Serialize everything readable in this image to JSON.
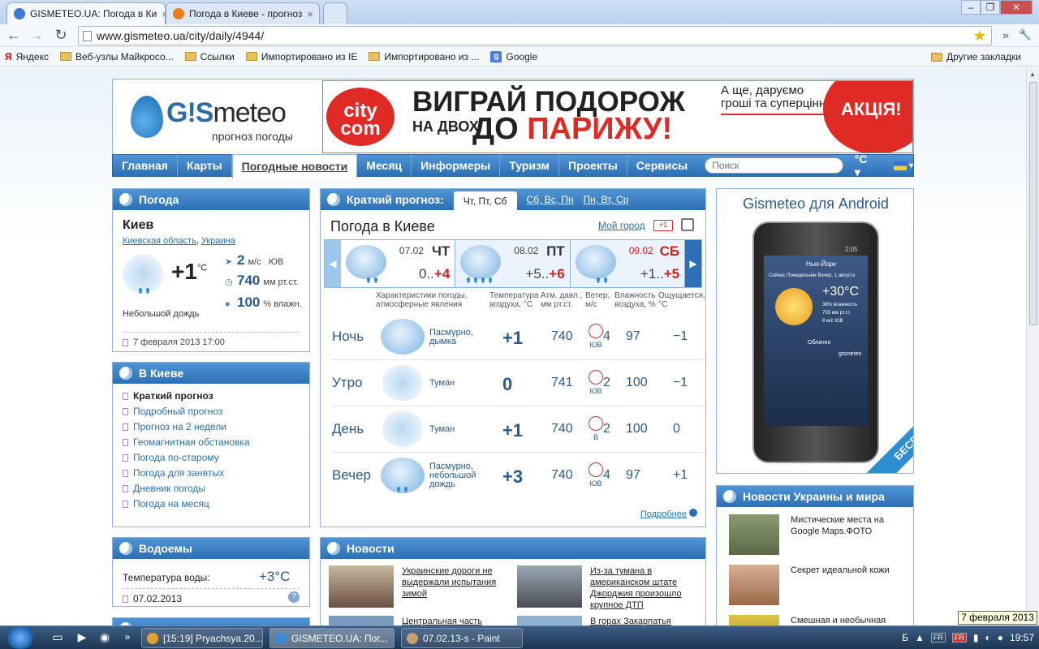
{
  "browser": {
    "tabs": [
      {
        "title": "GISMETEO.UA: Погода в Ки",
        "close": "×",
        "favicon_color": "#3b78d8",
        "active": true
      },
      {
        "title": "Погода в Киеве - прогноз",
        "close": "×",
        "favicon_color": "#ef7d12",
        "active": false
      }
    ],
    "window_controls": {
      "minimize": "–",
      "restore": "❐",
      "close": "✕"
    },
    "url": "www.gismeteo.ua/city/daily/4944/",
    "nav": {
      "back": "←",
      "forward": "→",
      "reload": "↻",
      "more": "»",
      "wrench": "🔧"
    },
    "bookmarks": [
      {
        "label": "Яндекс",
        "icon": "yandex-icon"
      },
      {
        "label": "Веб-узлы Майкросо...",
        "icon": "folder-icon"
      },
      {
        "label": "Ссылки",
        "icon": "folder-icon"
      },
      {
        "label": "Импортировано из IE",
        "icon": "folder-icon"
      },
      {
        "label": "Импортировано из ...",
        "icon": "folder-icon"
      },
      {
        "label": "Google",
        "icon": "google-icon"
      }
    ],
    "other_bookmarks": "Другие закладки"
  },
  "header": {
    "logo_prefix": "G!S",
    "logo_suffix": "meteo",
    "logo_sub": "прогноз погоды",
    "banner": {
      "brand": "city com",
      "line1": "ВИГРАЙ ПОДОРОЖ",
      "line2": "НА ДВОХ",
      "line3a": "ДО",
      "line3b": "ПАРИЖУ!",
      "note": "А ще, даруємо гроші та суперцінні!",
      "promo": "АКЦІЯ!"
    }
  },
  "menu": {
    "items": [
      "Главная",
      "Карты",
      "Погодные новости",
      "Месяц",
      "Информеры",
      "Туризм",
      "Проекты",
      "Сервисы"
    ],
    "search_placeholder": "Поиск",
    "unit": "°C ▾",
    "lang_arrow": "▾"
  },
  "weather_box": {
    "title": "Погода",
    "city": "Киев",
    "region": "Киевская область",
    "country": "Украина",
    "temp": "+1",
    "temp_unit": "°C",
    "wind_value": "2",
    "wind_unit": "м/с",
    "wind_dir": "ЮВ",
    "pressure_value": "740",
    "pressure_unit": "мм рт.ст.",
    "humidity_value": "100",
    "humidity_unit": "% влажн.",
    "description": "Небольшой дождь",
    "date": "7 февраля 2013 17:00"
  },
  "kiev_box": {
    "title": "В Киеве",
    "links": [
      "Краткий прогноз",
      "Подробный прогноз",
      "Прогноз на 2 недели",
      "Геомагнитная обстановка",
      "Погода по-старому",
      "Погода для занятых",
      "Дневник погоды",
      "Погода на месяц"
    ]
  },
  "water_box": {
    "title": "Водоемы",
    "label": "Температура воды:",
    "value": "+3°C",
    "date": "07.02.2013",
    "help": "?"
  },
  "forecast": {
    "header_label": "Краткий прогноз:",
    "tabs": [
      "Чт, Пт, Сб",
      "Сб, Вс, Пн",
      "Пн, Вт, Ср"
    ],
    "title": "Погода в Киеве",
    "my_city": "Мой город",
    "gplus": "+1",
    "days": [
      {
        "date": "07.02",
        "weekday": "ЧТ",
        "min": "0..",
        "max": "+4"
      },
      {
        "date": "08.02",
        "weekday": "ПТ",
        "min": "+5..",
        "max": "+6"
      },
      {
        "date": "09.02",
        "weekday": "СБ",
        "min": "+1..",
        "max": "+5"
      }
    ],
    "columns": {
      "conditions": "Характеристики погоды, атмосферные явления",
      "temp": "Температура воздуха, °C",
      "pressure": "Атм. давл., мм рт.ст.",
      "wind": "Ветер, м/с",
      "humidity": "Влажность воздуха, %",
      "feels": "Ощущается, °C"
    },
    "rows": [
      {
        "time": "Ночь",
        "desc": "Пасмурно, дымка",
        "temp": "+1",
        "pressure": "740",
        "wind_dir": "ЮВ",
        "wind": "4",
        "humidity": "97",
        "feels": "−1"
      },
      {
        "time": "Утро",
        "desc": "Туман",
        "temp": "0",
        "pressure": "741",
        "wind_dir": "ЮВ",
        "wind": "2",
        "humidity": "100",
        "feels": "−1"
      },
      {
        "time": "День",
        "desc": "Туман",
        "temp": "+1",
        "pressure": "740",
        "wind_dir": "В",
        "wind": "2",
        "humidity": "100",
        "feels": "0"
      },
      {
        "time": "Вечер",
        "desc": "Пасмурно, небольшой дождь",
        "temp": "+3",
        "pressure": "740",
        "wind_dir": "ЮВ",
        "wind": "4",
        "humidity": "97",
        "feels": "+1"
      }
    ],
    "more": "Подробнее"
  },
  "news_box": {
    "title": "Новости",
    "items": [
      "Украинские дороги не выдержали испытания зимой",
      "Из-за тумана в американском штате Джорджия произошло крупное ДТП",
      "Центральная часть",
      "В горах Закарпатья"
    ]
  },
  "android": {
    "title": "Gismeteo для Android",
    "badge": "БЕСПЛАТНО",
    "screen_city": "Нью-Йорк",
    "screen_now": "Сейчас Понедельник Вечер, 1 августа",
    "screen_temp": "+30°C",
    "screen_hum": "38% влажность",
    "screen_press": "755 мм рт.ст.",
    "screen_wind": "8 м/с ЮВ",
    "screen_desc": "Облачно",
    "screen_brand": "gismeteo",
    "screen_time": "2:05"
  },
  "world_news": {
    "title": "Новости Украины и мира",
    "items": [
      "Мистические места на Google Maps.ФОТО",
      "Секрет идеальной кожи",
      "Смешная и необычная"
    ]
  },
  "taskbar": {
    "tasks": [
      "[15:19] Pryachsya.20...",
      "GISMETEO.UA: Пог...",
      "07.02.13-s - Paint"
    ],
    "more": "»",
    "lang": "Б",
    "clock": "19:57",
    "tooltip": "7 февраля 2013 г."
  }
}
